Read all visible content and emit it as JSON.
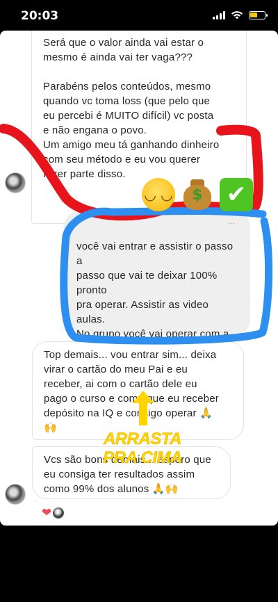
{
  "status_bar": {
    "time": "20:03"
  },
  "messages": [
    {
      "lines_a": "Será que o valor ainda vai estar o\nmesmo é ainda vai ter vaga???",
      "lines_b": "Parabéns pelos conteúdos, mesmo\nquando vc toma loss (que pelo que\neu percebi é MUITO difícil) vc posta\ne não engana o povo.\nUm amigo meu tá ganhando dinheiro\ncom seu método e eu vou querer\nfazer parte disso."
    },
    {
      "top_fragment": "...",
      "text": "você vai entrar e assistir o passo a\npasso que vai te deixar 100% pronto\npra operar. Assistir as video aulas.\nNo grupo você vai operar com a\ngente todos os dias e pegar\nexatamente as minhas entradas."
    },
    {
      "text": "Top demais... vou entrar sim... deixa\nvirar o cartão do meu Pai e eu\nreceber, ai com o cartão dele eu\npago o curso e como que eu receber\ndepósito na IQ e consigo operar 🙏\n🙌"
    },
    {
      "text": "Vcs são bons demais... espero que\neu consiga ter resultados assim\ncomo 99% dos alunos 🙏🙌"
    }
  ],
  "reaction": {
    "heart": "❤"
  },
  "overlay": {
    "emojis": [
      "relieved-face",
      "money-bag",
      "check-mark"
    ],
    "check_glyph": "✔",
    "face_glyph": "◡ ◡",
    "money_glyph": "$",
    "sticker_line1": "ARRASTA",
    "sticker_line2": "PRA CIMA"
  },
  "colors": {
    "red_scribble": "#e8141c",
    "blue_scribble": "#2d8ff0",
    "sticker": "#ffd400"
  }
}
